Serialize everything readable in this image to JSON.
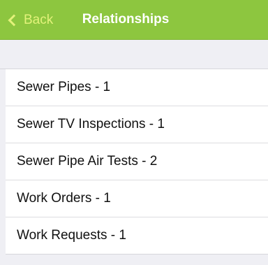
{
  "navbar": {
    "back_label": "Back",
    "title": "Relationships",
    "background_color": "#8dc63f",
    "back_color": "#e3f27a"
  },
  "relationships": {
    "items": [
      {
        "label": "Sewer Pipes - 1"
      },
      {
        "label": "Sewer TV Inspections - 1"
      },
      {
        "label": "Sewer Pipe Air Tests - 2"
      },
      {
        "label": "Work Orders - 1"
      },
      {
        "label": "Work Requests - 1"
      }
    ]
  }
}
